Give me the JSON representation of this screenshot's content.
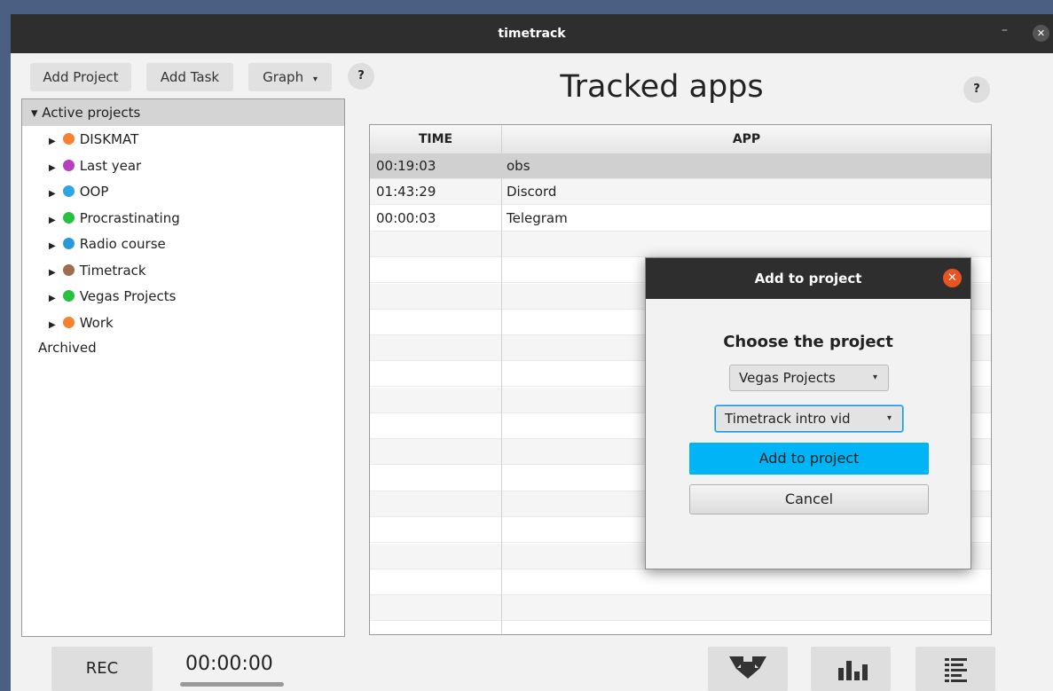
{
  "window": {
    "title": "timetrack",
    "minimize": "–",
    "close": "✕"
  },
  "toolbar": {
    "add_project": "Add Project",
    "add_task": "Add Task",
    "graph": "Graph",
    "graph_caret": "▾",
    "help": "?"
  },
  "tree": {
    "header": "▾ Active projects",
    "items": [
      {
        "label": "DISKMAT",
        "color": "#f7812f"
      },
      {
        "label": "Last year",
        "color": "#b43fbf"
      },
      {
        "label": "OOP",
        "color": "#2da5e6"
      },
      {
        "label": "Procrastinating",
        "color": "#25c13f"
      },
      {
        "label": "Radio course",
        "color": "#2b98d8"
      },
      {
        "label": "Timetrack",
        "color": "#9d6d4e"
      },
      {
        "label": "Vegas Projects",
        "color": "#25c13f"
      },
      {
        "label": "Work",
        "color": "#f7812f"
      }
    ],
    "archived": "Archived"
  },
  "main": {
    "heading": "Tracked apps",
    "help": "?",
    "columns": {
      "time": "TIME",
      "app": "APP"
    },
    "rows": [
      {
        "time": "00:19:03",
        "app": "obs"
      },
      {
        "time": "01:43:29",
        "app": "Discord"
      },
      {
        "time": "00:00:03",
        "app": "Telegram"
      }
    ]
  },
  "dialog": {
    "title": "Add to project",
    "close": "✕",
    "prompt": "Choose the project",
    "project_select": "Vegas Projects",
    "task_select": "Timetrack intro vid",
    "caret": "▾",
    "confirm": "Add to project",
    "cancel": "Cancel"
  },
  "footer": {
    "rec": "REC",
    "timer": "00:00:00",
    "icons": [
      "import-icon",
      "bar-chart-icon",
      "list-icon"
    ]
  }
}
